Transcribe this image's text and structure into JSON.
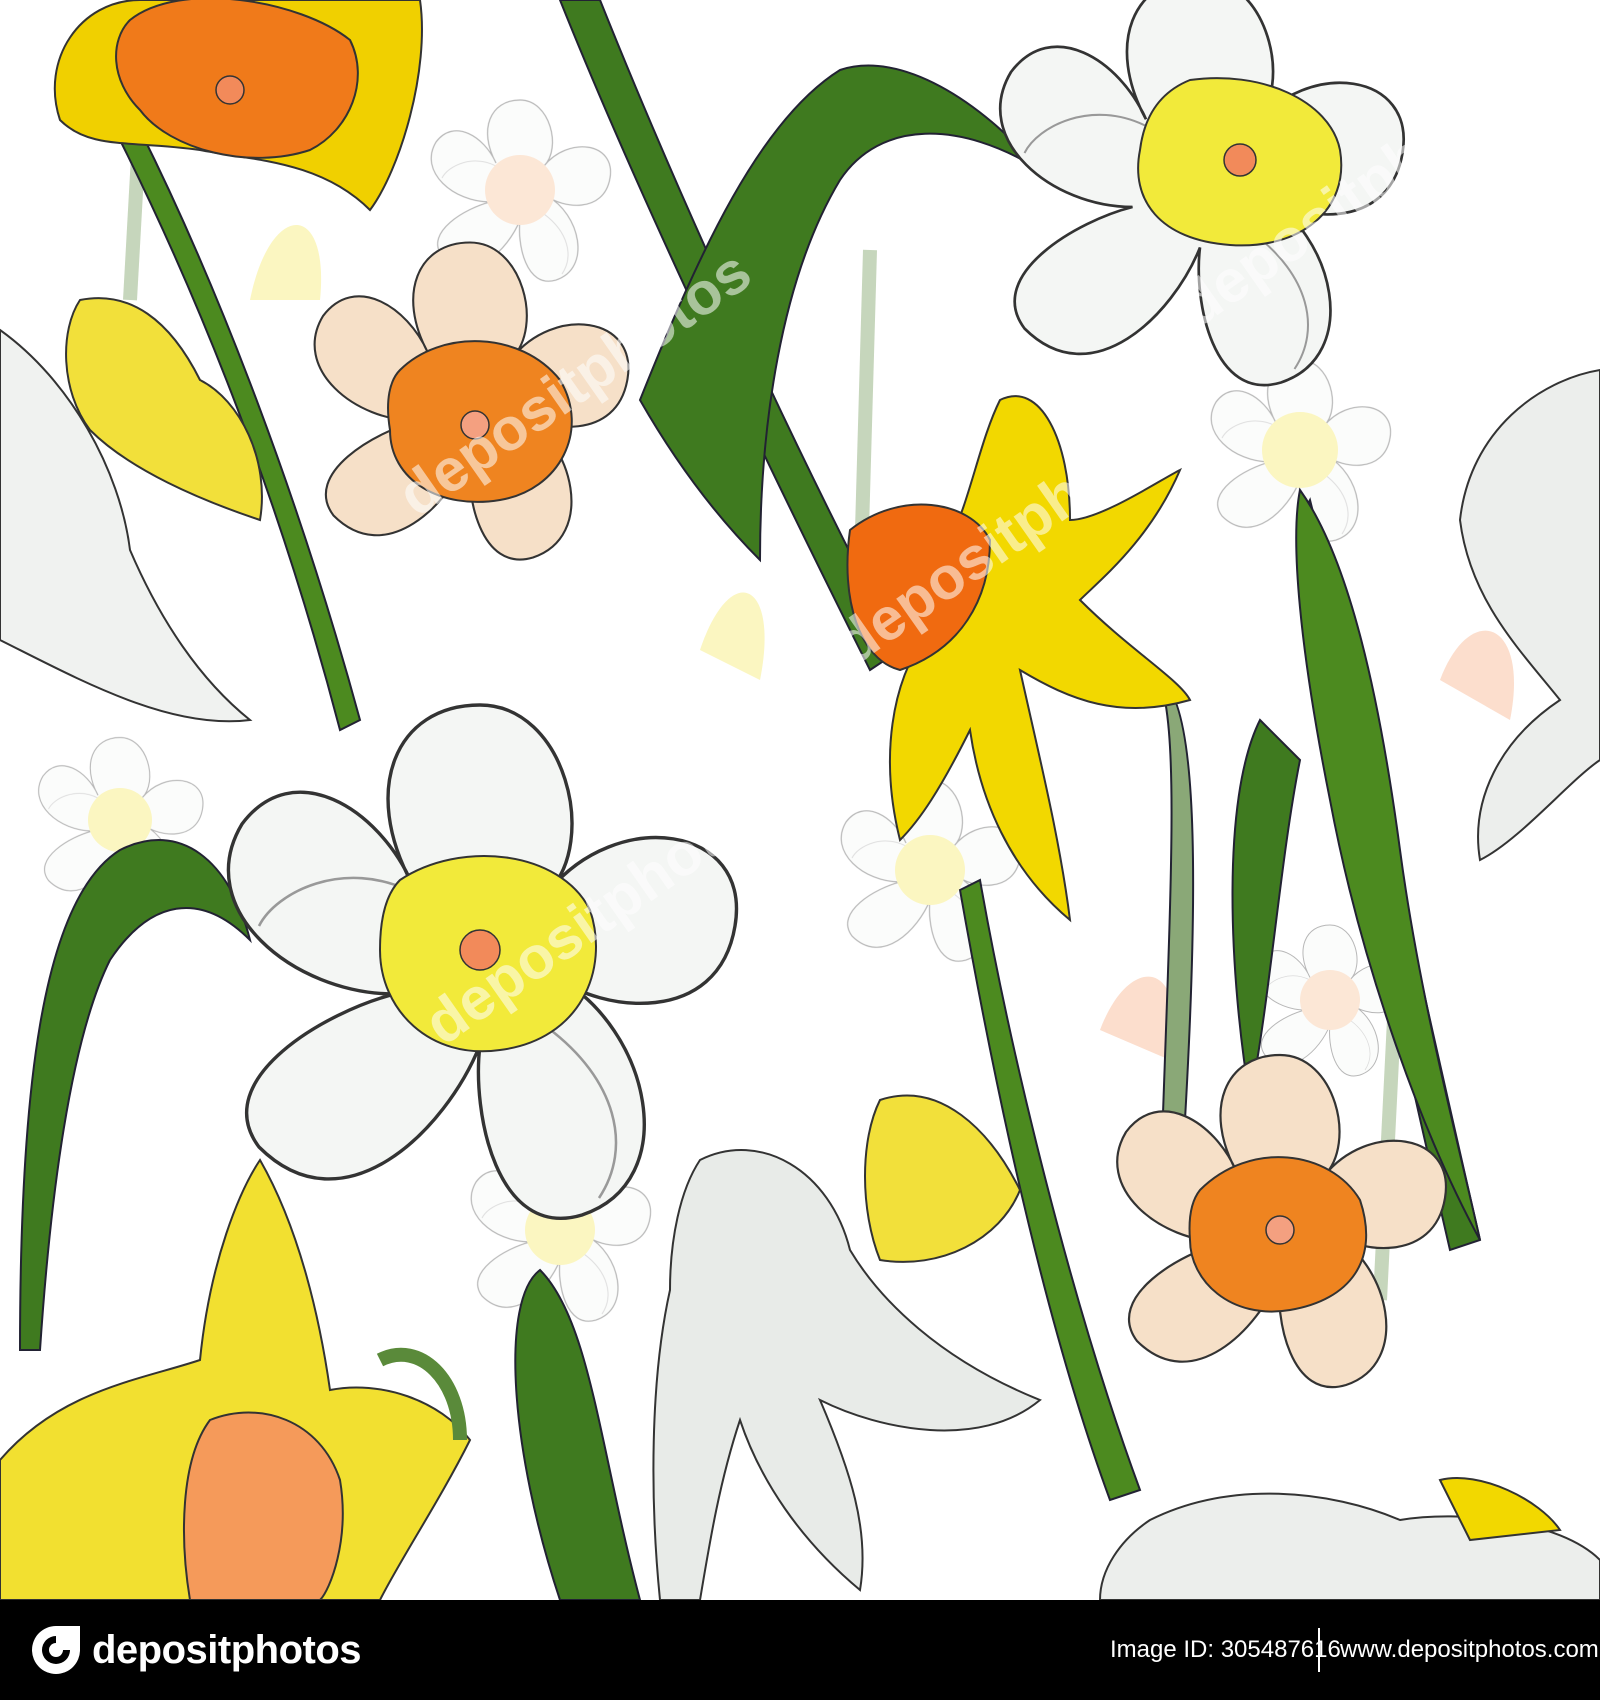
{
  "footer": {
    "brand": "depositphotos",
    "image_id": "Image ID: 305487616",
    "site_url": "www.depositphotos.com",
    "logo_icon": "depositphotos-logo-icon"
  },
  "watermark": {
    "text": "depositphotos"
  },
  "colors": {
    "leaf_green": "#3f7a1f",
    "yellow": "#f2dc2a",
    "orange": "#f07a1a",
    "peach": "#f5dcc0",
    "white_petal": "#f4f6f4",
    "grey_petal": "#dcdfdc",
    "footer_bg": "#000000"
  }
}
